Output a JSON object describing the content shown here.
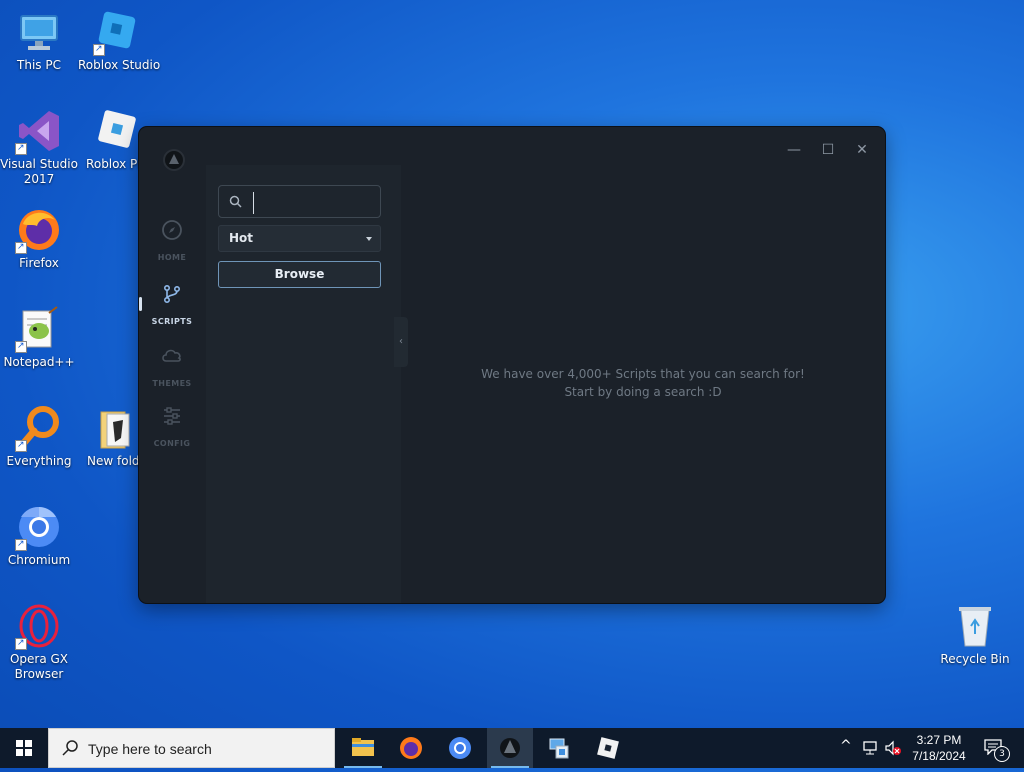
{
  "desktop": {
    "icons": [
      {
        "label": "This PC"
      },
      {
        "label": "Roblox Studio"
      },
      {
        "label": "Visual Studio 2017"
      },
      {
        "label": "Roblox Pla"
      },
      {
        "label": "Firefox"
      },
      {
        "label": "Notepad++"
      },
      {
        "label": "Everything"
      },
      {
        "label": "New folde"
      },
      {
        "label": "Chromium"
      },
      {
        "label": "Opera GX Browser"
      },
      {
        "label": "Recycle Bin"
      }
    ]
  },
  "app": {
    "rail": [
      {
        "label": "HOME",
        "icon": "compass-icon"
      },
      {
        "label": "SCRIPTS",
        "icon": "git-branch-icon"
      },
      {
        "label": "THEMES",
        "icon": "cloud-icon"
      },
      {
        "label": "CONFIG",
        "icon": "sliders-icon"
      }
    ],
    "search": {
      "value": "",
      "placeholder": ""
    },
    "sort": {
      "selected": "Hot"
    },
    "browse_label": "Browse",
    "empty": {
      "line1": "We have over 4,000+ Scripts that you can search for!",
      "line2": "Start by doing a search :D"
    },
    "window_controls": {
      "minimize": "—",
      "maximize": "☐",
      "close": "✕"
    }
  },
  "taskbar": {
    "search_placeholder": "Type here to search",
    "time": "3:27 PM",
    "date": "7/18/2024",
    "notification_count": "3"
  }
}
